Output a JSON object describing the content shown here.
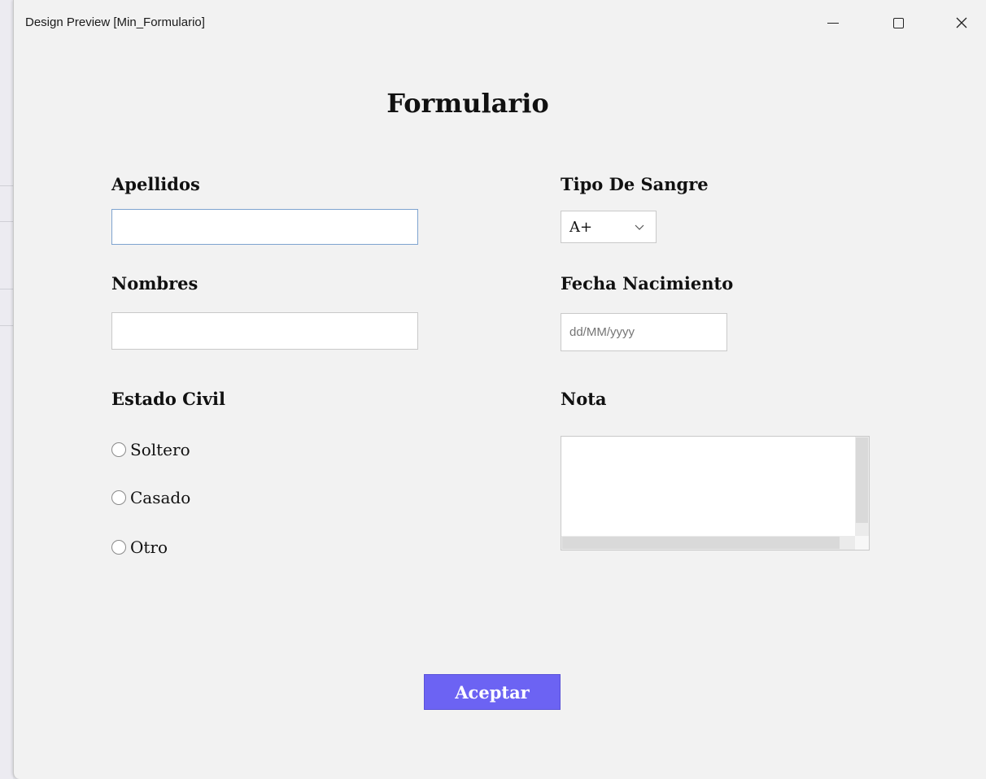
{
  "window": {
    "title": "Design Preview [Min_Formulario]"
  },
  "form": {
    "heading": "Formulario",
    "apellidos": {
      "label": "Apellidos",
      "value": ""
    },
    "nombres": {
      "label": "Nombres",
      "value": ""
    },
    "tipo_sangre": {
      "label": "Tipo De Sangre",
      "selected": "A+"
    },
    "fecha_nacimiento": {
      "label": "Fecha Nacimiento",
      "placeholder": "dd/MM/yyyy"
    },
    "estado_civil": {
      "label": "Estado Civil",
      "options": [
        "Soltero",
        "Casado",
        "Otro"
      ]
    },
    "nota": {
      "label": "Nota",
      "value": ""
    },
    "accept_label": "Aceptar"
  },
  "colors": {
    "accent": "#6c63f3",
    "window_bg": "#f2f2f2",
    "focus_border": "#7ea3cf"
  },
  "icons": {
    "minimize": "minimize-icon",
    "maximize": "maximize-icon",
    "close": "close-icon",
    "dropdown": "chevron-down-icon"
  }
}
